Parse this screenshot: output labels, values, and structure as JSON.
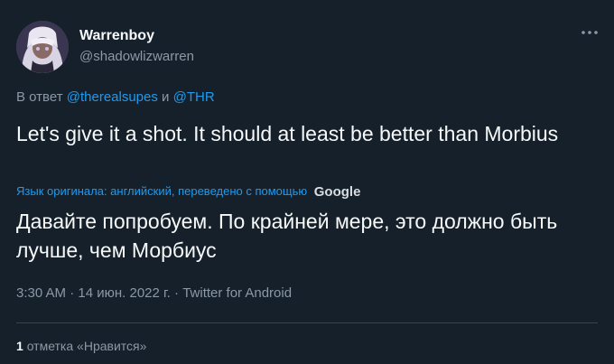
{
  "author": {
    "display_name": "Warrenboy",
    "handle": "@shadowlizwarren",
    "avatar_icon": "anime-avatar"
  },
  "reply": {
    "prefix": "В ответ",
    "mention_1": "@therealsupes",
    "conjunction": "и",
    "mention_2": "@THR"
  },
  "tweet": {
    "text": "Let's give it a shot. It should at least be better than Morbius",
    "translation_note": "Язык оригинала: английский, переведено с помощью",
    "translation_provider": "Google",
    "translated_text": "Давайте попробуем. По крайней мере, это должно быть лучше, чем Морбиус"
  },
  "meta": {
    "time": "3:30 AM",
    "separator": "·",
    "date": "14 июн. 2022 г.",
    "source": "Twitter for Android"
  },
  "engagement": {
    "like_count": "1",
    "like_label": "отметка «Нравится»"
  },
  "colors": {
    "background": "#15202b",
    "text": "#f7f9f9",
    "secondary": "#8b98a5",
    "accent": "#1d9bf0"
  }
}
